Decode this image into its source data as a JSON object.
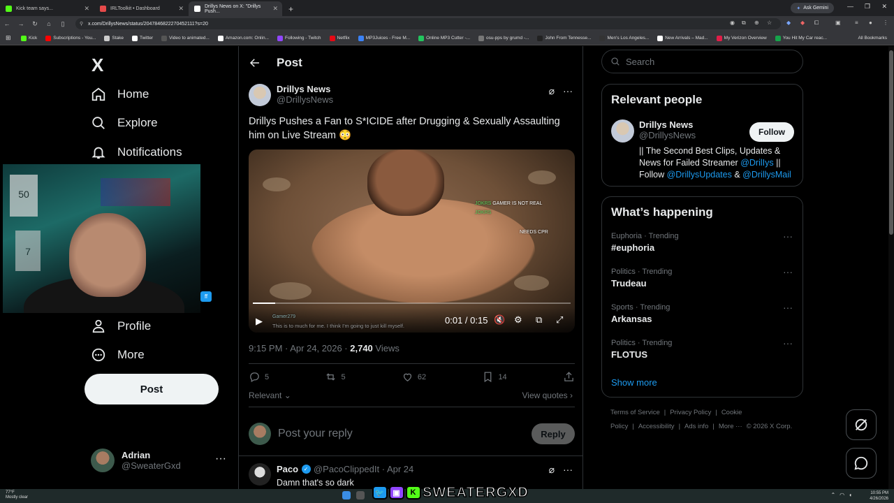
{
  "browser": {
    "tabs": [
      {
        "label": "Kick team says...",
        "color": "#53fc18"
      },
      {
        "label": "IRLToolkit • Dashboard",
        "color": "#e64a4a"
      },
      {
        "label": "Drillys News on X: \"Drillys Push...",
        "color": "#ffffff",
        "active": true
      }
    ],
    "new_tab": "+",
    "ask_gemini": "Ask Gemini",
    "url": "x.com/DrillysNews/status/2047846822270452111?s=20",
    "bookmarks": [
      {
        "label": "Kick",
        "color": "#53fc18"
      },
      {
        "label": "Subscriptions - You...",
        "color": "#ff0000"
      },
      {
        "label": "Stake",
        "color": "#cccccc"
      },
      {
        "label": "Twitter",
        "color": "#ffffff"
      },
      {
        "label": "Video to animated...",
        "color": "#555555"
      },
      {
        "label": "Amazon.com: Onlin...",
        "color": "#ffffff"
      },
      {
        "label": "Following - Twitch",
        "color": "#9146ff"
      },
      {
        "label": "Netflix",
        "color": "#e50914"
      },
      {
        "label": "MP3Juices - Free M...",
        "color": "#3b82f6"
      },
      {
        "label": "Online MP3 Cutter -...",
        "color": "#22c55e"
      },
      {
        "label": "osu-pps by grumd -...",
        "color": "#777777"
      },
      {
        "label": "John From Tennesse...",
        "color": "#222222"
      },
      {
        "label": "Men's Los Angeles...",
        "color": "#333333"
      },
      {
        "label": "New Arrivals – Mad...",
        "color": "#ffffff"
      },
      {
        "label": "My Verizon Overview",
        "color": "#e11d48"
      },
      {
        "label": "You Hit My Car reac...",
        "color": "#16a34a"
      }
    ],
    "all_bookmarks": "All Bookmarks"
  },
  "nav": {
    "logo": "X",
    "items": [
      {
        "label": "Home",
        "icon": "home-icon"
      },
      {
        "label": "Explore",
        "icon": "search-icon"
      },
      {
        "label": "Notifications",
        "icon": "bell-icon"
      },
      {
        "label": "Profile",
        "icon": "person-icon"
      },
      {
        "label": "More",
        "icon": "more-circle-icon"
      }
    ],
    "post_button": "Post",
    "user": {
      "name": "Adrian",
      "handle": "@SweaterGxd"
    }
  },
  "overlay": {
    "ff_label": "ff"
  },
  "post": {
    "header": "Post",
    "author": {
      "name": "Drillys News",
      "handle": "@DrillysNews"
    },
    "text": "Drillys Pushes a Fan to S*ICIDE after Drugging & Sexually Assaulting him on Live Stream 😳",
    "video": {
      "time": "0:01 / 0:15",
      "progress": 0.07,
      "chat": [
        {
          "user": "JOKRS",
          "text": "GAMER IS NOT REAL"
        },
        {
          "user": "JOKRS",
          "text": ""
        },
        {
          "user": "",
          "text": "NEEDS CPR"
        }
      ],
      "caption_user": "Gamer279",
      "caption_text": "This is to much for me. I think I'm going to just kill myself."
    },
    "timestamp": "9:15 PM · Apr 24, 2026 · ",
    "views_count": "2,740",
    "views_label": " Views",
    "stats": {
      "replies": "5",
      "reposts": "5",
      "likes": "62",
      "bookmarks": "14"
    },
    "sort_label": "Relevant",
    "view_quotes": "View quotes",
    "reply_placeholder": "Post your reply",
    "reply_button": "Reply",
    "first_reply": {
      "name": "Paco",
      "handle": "@PacoClippedIt · Apr 24",
      "text": "Damn that's so dark"
    }
  },
  "sidebar": {
    "search_placeholder": "Search",
    "relevant_title": "Relevant people",
    "person": {
      "name": "Drillys News",
      "handle": "@DrillysNews",
      "follow": "Follow",
      "bio_1": "|| The Second Best Clips, Updates & News for Failed Streamer ",
      "bio_link1": "@DrilIys",
      "bio_2": " || Follow ",
      "bio_link2": "@DrillysUpdates",
      "bio_3": " & ",
      "bio_link3": "@DrillysMail"
    },
    "happening_title": "What’s happening",
    "trends": [
      {
        "context": "Euphoria · Trending",
        "name": "#euphoria"
      },
      {
        "context": "Politics · Trending",
        "name": "Trudeau"
      },
      {
        "context": "Sports · Trending",
        "name": "Arkansas"
      },
      {
        "context": "Politics · Trending",
        "name": "FLOTUS"
      }
    ],
    "show_more": "Show more",
    "footer": [
      "Terms of Service",
      "|",
      "Privacy Policy",
      "|",
      "Cookie Policy",
      "|",
      "Accessibility",
      "|",
      "Ads info",
      "|",
      "More ···",
      "© 2026 X Corp."
    ]
  },
  "taskbar": {
    "temp": "77°F",
    "weather": "Mostly clear",
    "brand": "SWEATERGXD",
    "time": "10:55 PM",
    "date": "4/26/2026"
  }
}
